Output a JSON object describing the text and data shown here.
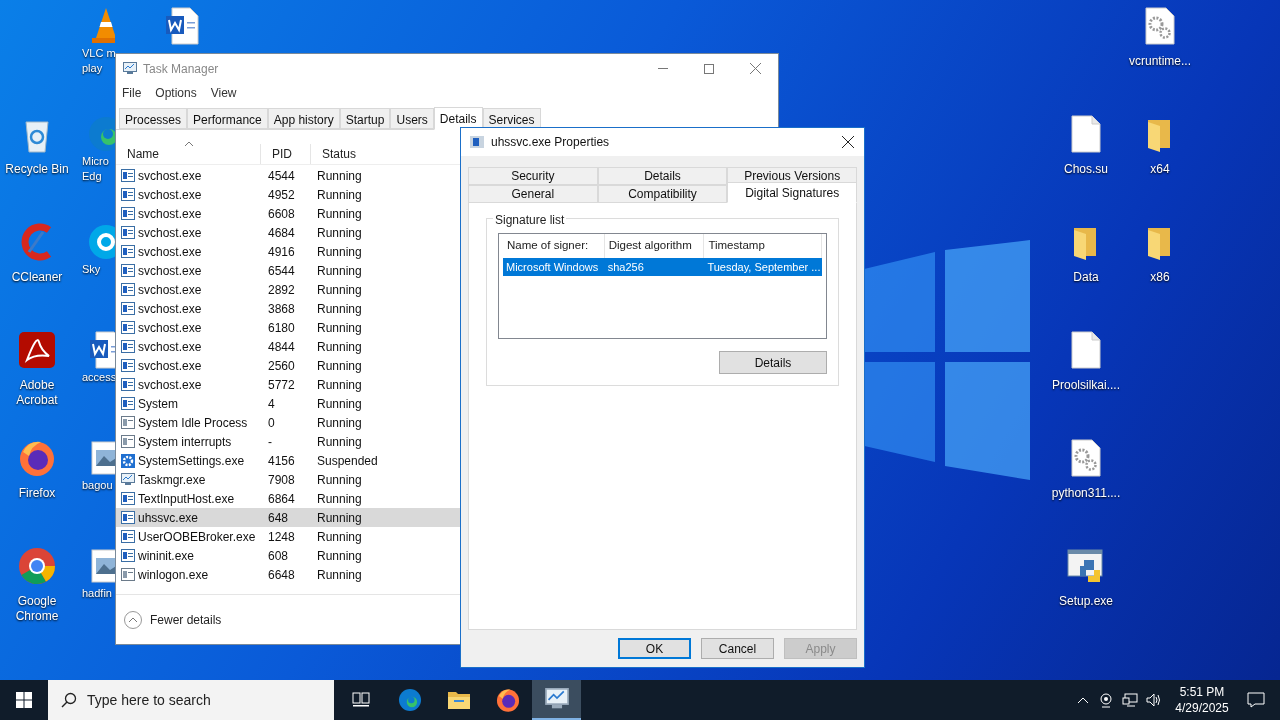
{
  "desktop_icons": [
    {
      "kind": "vlc",
      "lines": [
        "VLC m",
        "play"
      ]
    },
    {
      "kind": "word"
    },
    {
      "kind": "recycle",
      "lines": [
        "Recycle Bin"
      ]
    },
    {
      "kind": "edge",
      "lines": [
        "Micro",
        "Edg"
      ]
    },
    {
      "kind": "ccleaner",
      "lines": [
        "CCleaner"
      ]
    },
    {
      "kind": "skype",
      "lines": [
        "Sky"
      ]
    },
    {
      "kind": "acrobat",
      "lines": [
        "Adobe",
        "Acrobat"
      ]
    },
    {
      "kind": "word",
      "lines": [
        "access"
      ]
    },
    {
      "kind": "firefox",
      "lines": [
        "Firefox"
      ]
    },
    {
      "kind": "image",
      "lines": [
        "bagou"
      ]
    },
    {
      "kind": "chrome",
      "lines": [
        "Google",
        "Chrome"
      ]
    },
    {
      "kind": "image",
      "lines": [
        "hadfin"
      ]
    },
    {
      "kind": "gearfile",
      "lines": [
        "vcruntime..."
      ]
    },
    {
      "kind": "file",
      "lines": [
        "Chos.su"
      ]
    },
    {
      "kind": "folder",
      "lines": [
        "x64"
      ]
    },
    {
      "kind": "folder",
      "lines": [
        "Data"
      ]
    },
    {
      "kind": "folder",
      "lines": [
        "x86"
      ]
    },
    {
      "kind": "file",
      "lines": [
        "Proolsilkai...."
      ]
    },
    {
      "kind": "gearfile",
      "lines": [
        "python311...."
      ]
    },
    {
      "kind": "python",
      "lines": [
        "Setup.exe"
      ]
    }
  ],
  "task_manager": {
    "title": "Task Manager",
    "menu": [
      "File",
      "Options",
      "View"
    ],
    "tabs": [
      {
        "label": "Processes",
        "selected": false
      },
      {
        "label": "Performance",
        "selected": false
      },
      {
        "label": "App history",
        "selected": false
      },
      {
        "label": "Startup",
        "selected": false
      },
      {
        "label": "Users",
        "selected": false
      },
      {
        "label": "Details",
        "selected": true
      },
      {
        "label": "Services",
        "selected": false
      }
    ],
    "columns": [
      "Name",
      "PID",
      "Status"
    ],
    "rows": [
      {
        "kind": "service",
        "name": "svchost.exe",
        "pid": "4544",
        "status": "Running",
        "selected": false
      },
      {
        "kind": "service",
        "name": "svchost.exe",
        "pid": "4952",
        "status": "Running",
        "selected": false
      },
      {
        "kind": "service",
        "name": "svchost.exe",
        "pid": "6608",
        "status": "Running",
        "selected": false
      },
      {
        "kind": "service",
        "name": "svchost.exe",
        "pid": "4684",
        "status": "Running",
        "selected": false
      },
      {
        "kind": "service",
        "name": "svchost.exe",
        "pid": "4916",
        "status": "Running",
        "selected": false
      },
      {
        "kind": "service",
        "name": "svchost.exe",
        "pid": "6544",
        "status": "Running",
        "selected": false
      },
      {
        "kind": "service",
        "name": "svchost.exe",
        "pid": "2892",
        "status": "Running",
        "selected": false
      },
      {
        "kind": "service",
        "name": "svchost.exe",
        "pid": "3868",
        "status": "Running",
        "selected": false
      },
      {
        "kind": "service",
        "name": "svchost.exe",
        "pid": "6180",
        "status": "Running",
        "selected": false
      },
      {
        "kind": "service",
        "name": "svchost.exe",
        "pid": "4844",
        "status": "Running",
        "selected": false
      },
      {
        "kind": "service",
        "name": "svchost.exe",
        "pid": "2560",
        "status": "Running",
        "selected": false
      },
      {
        "kind": "service",
        "name": "svchost.exe",
        "pid": "5772",
        "status": "Running",
        "selected": false
      },
      {
        "kind": "service",
        "name": "System",
        "pid": "4",
        "status": "Running",
        "selected": false
      },
      {
        "kind": "system",
        "name": "System Idle Process",
        "pid": "0",
        "status": "Running",
        "selected": false
      },
      {
        "kind": "system",
        "name": "System interrupts",
        "pid": "-",
        "status": "Running",
        "selected": false
      },
      {
        "kind": "settings",
        "name": "SystemSettings.exe",
        "pid": "4156",
        "status": "Suspended",
        "selected": false
      },
      {
        "kind": "taskmgr",
        "name": "Taskmgr.exe",
        "pid": "7908",
        "status": "Running",
        "selected": false
      },
      {
        "kind": "service",
        "name": "TextInputHost.exe",
        "pid": "6864",
        "status": "Running",
        "selected": false
      },
      {
        "kind": "service",
        "name": "uhssvc.exe",
        "pid": "648",
        "status": "Running",
        "selected": true
      },
      {
        "kind": "service",
        "name": "UserOOBEBroker.exe",
        "pid": "1248",
        "status": "Running",
        "selected": false
      },
      {
        "kind": "service",
        "name": "wininit.exe",
        "pid": "608",
        "status": "Running",
        "selected": false
      },
      {
        "kind": "system",
        "name": "winlogon.exe",
        "pid": "6648",
        "status": "Running",
        "selected": false
      }
    ],
    "footer": "Fewer details"
  },
  "properties": {
    "title": "uhssvc.exe Properties",
    "tab_rows": [
      [
        {
          "label": "Security",
          "selected": false
        },
        {
          "label": "Details",
          "selected": false
        },
        {
          "label": "Previous Versions",
          "selected": false
        }
      ],
      [
        {
          "label": "General",
          "selected": false
        },
        {
          "label": "Compatibility",
          "selected": false
        },
        {
          "label": "Digital Signatures",
          "selected": true
        }
      ]
    ],
    "group_title": "Signature list",
    "columns": [
      "Name of signer:",
      "Digest algorithm",
      "Timestamp"
    ],
    "rows": [
      {
        "cells": [
          "Microsoft Windows",
          "sha256",
          "Tuesday, September ..."
        ],
        "selected": true
      }
    ],
    "details_button": "Details",
    "buttons": [
      {
        "label": "OK",
        "default": true,
        "disabled": false
      },
      {
        "label": "Cancel",
        "default": false,
        "disabled": false
      },
      {
        "label": "Apply",
        "default": false,
        "disabled": true
      }
    ]
  },
  "taskbar": {
    "search_placeholder": "Type here to search",
    "apps": [
      {
        "kind": "taskview",
        "selected": false
      },
      {
        "kind": "edge",
        "selected": false
      },
      {
        "kind": "explorer",
        "selected": false
      },
      {
        "kind": "firefox",
        "selected": false
      },
      {
        "kind": "taskmgr",
        "selected": true
      }
    ],
    "time": "5:51 PM",
    "date": "4/29/2025"
  }
}
